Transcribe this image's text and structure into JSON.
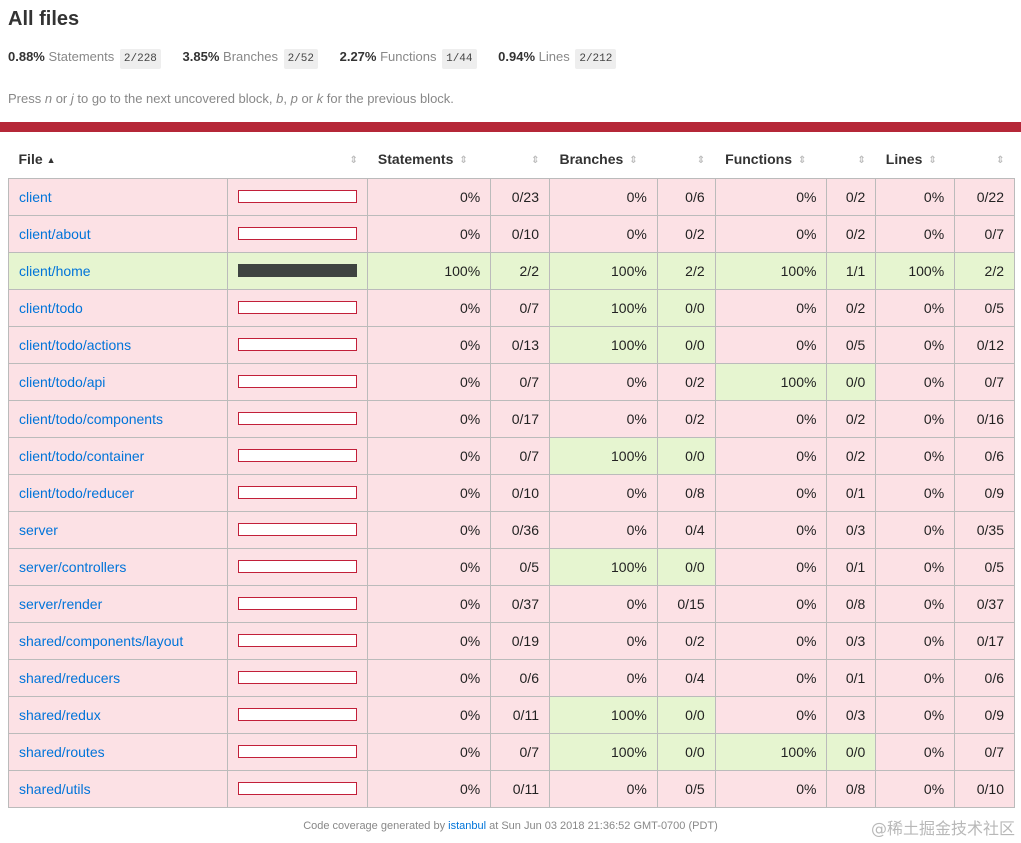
{
  "page": {
    "title": "All files",
    "summary": [
      {
        "pct": "0.88%",
        "label": "Statements",
        "fraction": "2/228"
      },
      {
        "pct": "3.85%",
        "label": "Branches",
        "fraction": "2/52"
      },
      {
        "pct": "2.27%",
        "label": "Functions",
        "fraction": "1/44"
      },
      {
        "pct": "0.94%",
        "label": "Lines",
        "fraction": "2/212"
      }
    ],
    "hint": {
      "p1": "Press ",
      "k1": "n",
      "p2": " or ",
      "k2": "j",
      "p3": " to go to the next uncovered block, ",
      "k3": "b",
      "p4": ", ",
      "k4": "p",
      "p5": " or ",
      "k5": "k",
      "p6": " for the previous block."
    }
  },
  "colors": {
    "status_bar": "#b52738",
    "low": "#fce1e5",
    "high": "#e6f5d0",
    "bar_fill": "#3f4441",
    "link": "#0074d9"
  },
  "table": {
    "headers": {
      "file": "File",
      "statements": "Statements",
      "branches": "Branches",
      "functions": "Functions",
      "lines": "Lines"
    },
    "rows": [
      {
        "file": "client",
        "coverage": 0,
        "s_pct": "0%",
        "s_frac": "0/23",
        "b_pct": "0%",
        "b_frac": "0/6",
        "f_pct": "0%",
        "f_frac": "0/2",
        "l_pct": "0%",
        "l_frac": "0/22",
        "s_level": "low",
        "b_level": "low",
        "f_level": "low",
        "l_level": "low"
      },
      {
        "file": "client/about",
        "coverage": 0,
        "s_pct": "0%",
        "s_frac": "0/10",
        "b_pct": "0%",
        "b_frac": "0/2",
        "f_pct": "0%",
        "f_frac": "0/2",
        "l_pct": "0%",
        "l_frac": "0/7",
        "s_level": "low",
        "b_level": "low",
        "f_level": "low",
        "l_level": "low"
      },
      {
        "file": "client/home",
        "coverage": 1,
        "s_pct": "100%",
        "s_frac": "2/2",
        "b_pct": "100%",
        "b_frac": "2/2",
        "f_pct": "100%",
        "f_frac": "1/1",
        "l_pct": "100%",
        "l_frac": "2/2",
        "s_level": "high",
        "b_level": "high",
        "f_level": "high",
        "l_level": "high"
      },
      {
        "file": "client/todo",
        "coverage": 0,
        "s_pct": "0%",
        "s_frac": "0/7",
        "b_pct": "100%",
        "b_frac": "0/0",
        "f_pct": "0%",
        "f_frac": "0/2",
        "l_pct": "0%",
        "l_frac": "0/5",
        "s_level": "low",
        "b_level": "high",
        "f_level": "low",
        "l_level": "low"
      },
      {
        "file": "client/todo/actions",
        "coverage": 0,
        "s_pct": "0%",
        "s_frac": "0/13",
        "b_pct": "100%",
        "b_frac": "0/0",
        "f_pct": "0%",
        "f_frac": "0/5",
        "l_pct": "0%",
        "l_frac": "0/12",
        "s_level": "low",
        "b_level": "high",
        "f_level": "low",
        "l_level": "low"
      },
      {
        "file": "client/todo/api",
        "coverage": 0,
        "s_pct": "0%",
        "s_frac": "0/7",
        "b_pct": "0%",
        "b_frac": "0/2",
        "f_pct": "100%",
        "f_frac": "0/0",
        "l_pct": "0%",
        "l_frac": "0/7",
        "s_level": "low",
        "b_level": "low",
        "f_level": "high",
        "l_level": "low"
      },
      {
        "file": "client/todo/components",
        "coverage": 0,
        "s_pct": "0%",
        "s_frac": "0/17",
        "b_pct": "0%",
        "b_frac": "0/2",
        "f_pct": "0%",
        "f_frac": "0/2",
        "l_pct": "0%",
        "l_frac": "0/16",
        "s_level": "low",
        "b_level": "low",
        "f_level": "low",
        "l_level": "low"
      },
      {
        "file": "client/todo/container",
        "coverage": 0,
        "s_pct": "0%",
        "s_frac": "0/7",
        "b_pct": "100%",
        "b_frac": "0/0",
        "f_pct": "0%",
        "f_frac": "0/2",
        "l_pct": "0%",
        "l_frac": "0/6",
        "s_level": "low",
        "b_level": "high",
        "f_level": "low",
        "l_level": "low"
      },
      {
        "file": "client/todo/reducer",
        "coverage": 0,
        "s_pct": "0%",
        "s_frac": "0/10",
        "b_pct": "0%",
        "b_frac": "0/8",
        "f_pct": "0%",
        "f_frac": "0/1",
        "l_pct": "0%",
        "l_frac": "0/9",
        "s_level": "low",
        "b_level": "low",
        "f_level": "low",
        "l_level": "low"
      },
      {
        "file": "server",
        "coverage": 0,
        "s_pct": "0%",
        "s_frac": "0/36",
        "b_pct": "0%",
        "b_frac": "0/4",
        "f_pct": "0%",
        "f_frac": "0/3",
        "l_pct": "0%",
        "l_frac": "0/35",
        "s_level": "low",
        "b_level": "low",
        "f_level": "low",
        "l_level": "low"
      },
      {
        "file": "server/controllers",
        "coverage": 0,
        "s_pct": "0%",
        "s_frac": "0/5",
        "b_pct": "100%",
        "b_frac": "0/0",
        "f_pct": "0%",
        "f_frac": "0/1",
        "l_pct": "0%",
        "l_frac": "0/5",
        "s_level": "low",
        "b_level": "high",
        "f_level": "low",
        "l_level": "low"
      },
      {
        "file": "server/render",
        "coverage": 0,
        "s_pct": "0%",
        "s_frac": "0/37",
        "b_pct": "0%",
        "b_frac": "0/15",
        "f_pct": "0%",
        "f_frac": "0/8",
        "l_pct": "0%",
        "l_frac": "0/37",
        "s_level": "low",
        "b_level": "low",
        "f_level": "low",
        "l_level": "low"
      },
      {
        "file": "shared/components/layout",
        "coverage": 0,
        "s_pct": "0%",
        "s_frac": "0/19",
        "b_pct": "0%",
        "b_frac": "0/2",
        "f_pct": "0%",
        "f_frac": "0/3",
        "l_pct": "0%",
        "l_frac": "0/17",
        "s_level": "low",
        "b_level": "low",
        "f_level": "low",
        "l_level": "low"
      },
      {
        "file": "shared/reducers",
        "coverage": 0,
        "s_pct": "0%",
        "s_frac": "0/6",
        "b_pct": "0%",
        "b_frac": "0/4",
        "f_pct": "0%",
        "f_frac": "0/1",
        "l_pct": "0%",
        "l_frac": "0/6",
        "s_level": "low",
        "b_level": "low",
        "f_level": "low",
        "l_level": "low"
      },
      {
        "file": "shared/redux",
        "coverage": 0,
        "s_pct": "0%",
        "s_frac": "0/11",
        "b_pct": "100%",
        "b_frac": "0/0",
        "f_pct": "0%",
        "f_frac": "0/3",
        "l_pct": "0%",
        "l_frac": "0/9",
        "s_level": "low",
        "b_level": "high",
        "f_level": "low",
        "l_level": "low"
      },
      {
        "file": "shared/routes",
        "coverage": 0,
        "s_pct": "0%",
        "s_frac": "0/7",
        "b_pct": "100%",
        "b_frac": "0/0",
        "f_pct": "100%",
        "f_frac": "0/0",
        "l_pct": "0%",
        "l_frac": "0/7",
        "s_level": "low",
        "b_level": "high",
        "f_level": "high",
        "l_level": "low"
      },
      {
        "file": "shared/utils",
        "coverage": 0,
        "s_pct": "0%",
        "s_frac": "0/11",
        "b_pct": "0%",
        "b_frac": "0/5",
        "f_pct": "0%",
        "f_frac": "0/8",
        "l_pct": "0%",
        "l_frac": "0/10",
        "s_level": "low",
        "b_level": "low",
        "f_level": "low",
        "l_level": "low"
      }
    ]
  },
  "footer": {
    "prefix": "Code coverage generated by ",
    "link": "istanbul",
    "suffix": " at Sun Jun 03 2018 21:36:52 GMT-0700 (PDT)"
  },
  "watermark": "@稀土掘金技术社区"
}
